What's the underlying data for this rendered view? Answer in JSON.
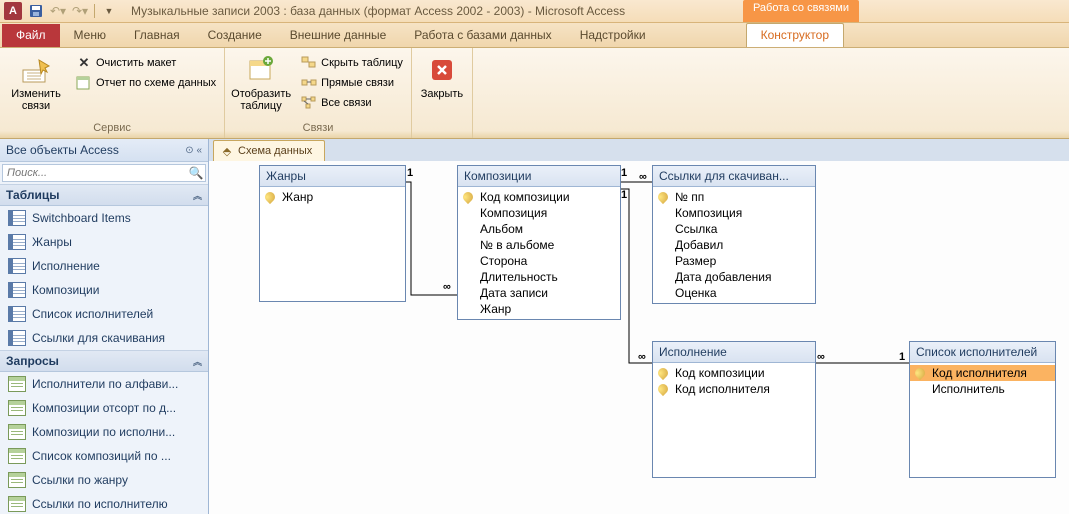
{
  "title": "Музыкальные записи 2003 : база данных (формат Access 2002 - 2003)  -  Microsoft Access",
  "context_tab_group": "Работа со связями",
  "tabs": {
    "file": "Файл",
    "menu": "Меню",
    "home": "Главная",
    "create": "Создание",
    "external": "Внешние данные",
    "dbtools": "Работа с базами данных",
    "addins": "Надстройки",
    "designer": "Конструктор"
  },
  "ribbon": {
    "group_service": "Сервис",
    "edit_rel": "Изменить связи",
    "clear_layout": "Очистить макет",
    "schema_report": "Отчет по схеме данных",
    "show_table": "Отобразить таблицу",
    "group_rel": "Связи",
    "hide_table": "Скрыть таблицу",
    "direct_rel": "Прямые связи",
    "all_rel": "Все связи",
    "close": "Закрыть"
  },
  "nav": {
    "header": "Все объекты Access",
    "search_ph": "Поиск...",
    "grp_tables": "Таблицы",
    "grp_queries": "Запросы",
    "tables": [
      "Switchboard Items",
      "Жанры",
      "Исполнение",
      "Композиции",
      "Список исполнителей",
      "Ссылки для скачивания"
    ],
    "queries": [
      "Исполнители по алфави...",
      "Композиции отсорт по д...",
      "Композиции по исполни...",
      "Список композиций  по ...",
      "Ссылки по жанру",
      "Ссылки по исполнителю"
    ]
  },
  "doc_tab": "Схема данных",
  "tables": {
    "genres": {
      "title": "Жанры",
      "fields": [
        {
          "n": "Жанр",
          "k": true
        }
      ]
    },
    "comp": {
      "title": "Композиции",
      "fields": [
        {
          "n": "Код композиции",
          "k": true
        },
        {
          "n": "Композиция"
        },
        {
          "n": "Альбом"
        },
        {
          "n": "№ в альбоме"
        },
        {
          "n": "Сторона"
        },
        {
          "n": "Длительность"
        },
        {
          "n": "Дата записи"
        },
        {
          "n": "Жанр"
        }
      ]
    },
    "links": {
      "title": "Ссылки для скачиван...",
      "fields": [
        {
          "n": "№ пп",
          "k": true
        },
        {
          "n": "Композиция"
        },
        {
          "n": "Ссылка"
        },
        {
          "n": "Добавил"
        },
        {
          "n": "Размер"
        },
        {
          "n": "Дата добавления"
        },
        {
          "n": "Оценка"
        }
      ]
    },
    "perf": {
      "title": "Исполнение",
      "fields": [
        {
          "n": "Код композиции",
          "k": true
        },
        {
          "n": "Код исполнителя",
          "k": true
        }
      ]
    },
    "artists": {
      "title": "Список исполнителей",
      "fields": [
        {
          "n": "Код исполнителя",
          "k": true,
          "sel": true
        },
        {
          "n": "Исполнитель"
        }
      ]
    }
  },
  "rel_labels": {
    "one": "1",
    "many": "∞"
  }
}
